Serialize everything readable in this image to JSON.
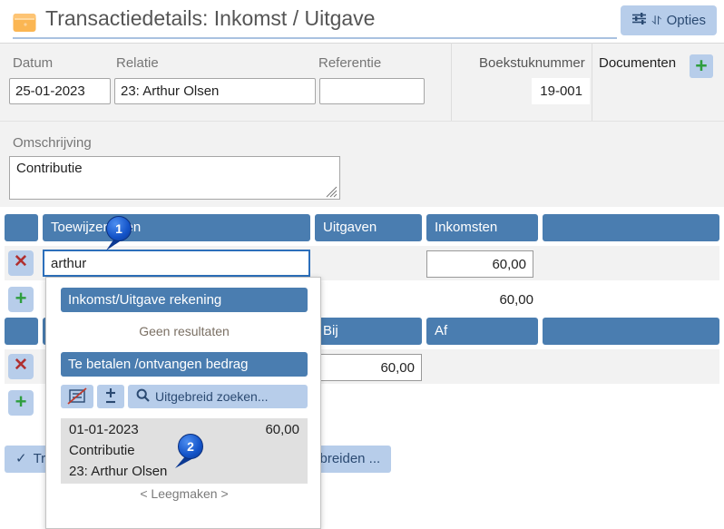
{
  "window": {
    "title": "Transactiedetails: Inkomst / Uitgave",
    "icon": "wallet-icon",
    "options_button": "Opties",
    "accent_blue": "#4a7db0",
    "button_blue": "#b7cdea",
    "marker_blue": "#1353c8"
  },
  "form": {
    "datum": {
      "label": "Datum",
      "value": "25-01-2023"
    },
    "relatie": {
      "label": "Relatie",
      "value": "23: Arthur Olsen"
    },
    "referentie": {
      "label": "Referentie",
      "value": ""
    },
    "boekstuknummer": {
      "label": "Boekstuknummer",
      "value": "19-001"
    },
    "documenten": {
      "label": "Documenten",
      "add_icon": "plus-icon"
    },
    "omschrijving": {
      "label": "Omschrijving",
      "value": "Contributie"
    }
  },
  "grid": {
    "headers_top": [
      "",
      "Toewijzeringen",
      "Uitgaven",
      "Inkomsten",
      ""
    ],
    "row1": {
      "delete_icon": "x-icon",
      "toewijzing_value": "arthur",
      "uitgaven": "",
      "inkomsten": "60,00"
    },
    "row_add": {
      "add_icon": "plus-icon"
    },
    "total": "60,00",
    "headers_bottom": [
      "",
      "",
      "Bij",
      "Af",
      ""
    ],
    "row2": {
      "delete_icon": "x-icon",
      "bij": "60,00",
      "af": ""
    },
    "row2_add": {
      "add_icon": "plus-icon"
    }
  },
  "dropdown": {
    "section_accounts": "Inkomst/Uitgave rekening",
    "no_results": "Geen resultaten",
    "section_amounts": "Te betalen /ontvangen bedrag",
    "tool_icons": [
      "no-invoice-icon",
      "plus-minus-icon"
    ],
    "advanced_search": "Uitgebreid zoeken...",
    "search_icon": "search-icon",
    "result": {
      "date": "01-01-2023",
      "amount": "60,00",
      "description": "Contributie",
      "relation": "23: Arthur Olsen"
    },
    "clear": "< Leegmaken >"
  },
  "footer": {
    "confirm_button": "Transactie opslaan",
    "confirm_icon": "check-icon",
    "expand_button": "Transactie uitbreiden ..."
  },
  "markers": [
    {
      "number": "1"
    },
    {
      "number": "2"
    }
  ]
}
